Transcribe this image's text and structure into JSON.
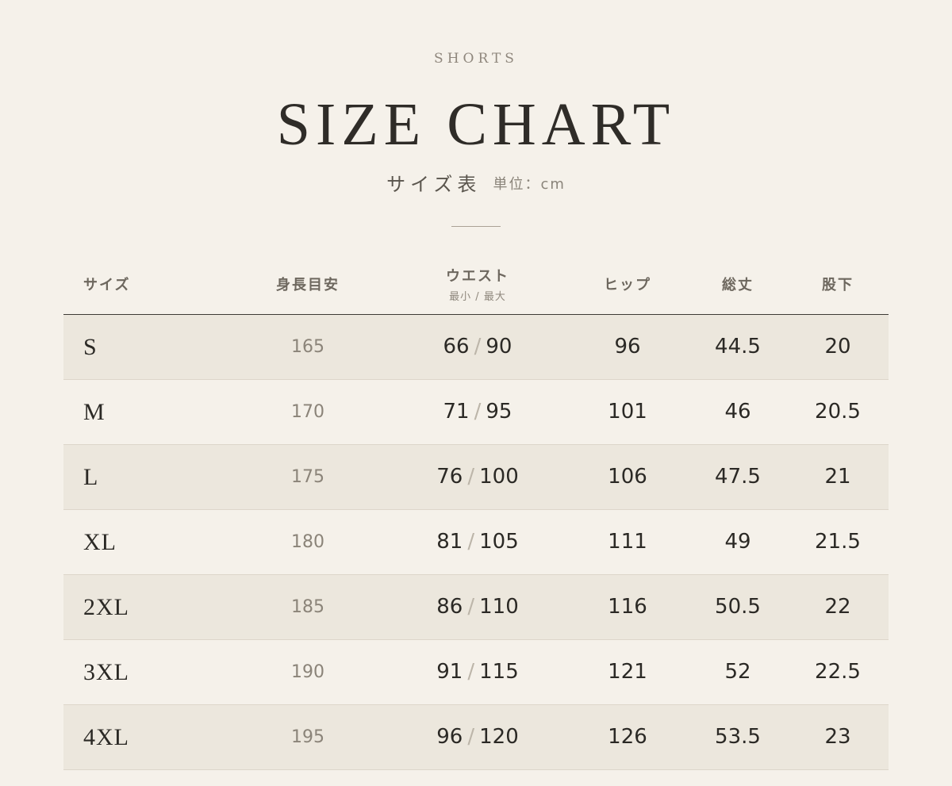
{
  "header": {
    "eyebrow": "SHORTS",
    "title": "SIZE CHART",
    "subtitle_jp": "サイズ表",
    "unit": "単位：cm"
  },
  "table": {
    "columns": {
      "size": "サイズ",
      "height": "身長目安",
      "waist": "ウエスト",
      "waist_sub": "最小 / 最大",
      "hip": "ヒップ",
      "length": "総丈",
      "inseam": "股下"
    },
    "rows": [
      {
        "size": "S",
        "height": "165",
        "waist_min": "66",
        "waist_max": "90",
        "hip": "96",
        "length": "44.5",
        "inseam": "20"
      },
      {
        "size": "M",
        "height": "170",
        "waist_min": "71",
        "waist_max": "95",
        "hip": "101",
        "length": "46",
        "inseam": "20.5"
      },
      {
        "size": "L",
        "height": "175",
        "waist_min": "76",
        "waist_max": "100",
        "hip": "106",
        "length": "47.5",
        "inseam": "21"
      },
      {
        "size": "XL",
        "height": "180",
        "waist_min": "81",
        "waist_max": "105",
        "hip": "111",
        "length": "49",
        "inseam": "21.5"
      },
      {
        "size": "2XL",
        "height": "185",
        "waist_min": "86",
        "waist_max": "110",
        "hip": "116",
        "length": "50.5",
        "inseam": "22"
      },
      {
        "size": "3XL",
        "height": "190",
        "waist_min": "91",
        "waist_max": "115",
        "hip": "121",
        "length": "52",
        "inseam": "22.5"
      },
      {
        "size": "4XL",
        "height": "195",
        "waist_min": "96",
        "waist_max": "120",
        "hip": "126",
        "length": "53.5",
        "inseam": "23"
      }
    ]
  },
  "colors": {
    "background": "#f5f1ea",
    "row_shaded": "#ece7dd",
    "text_primary": "#2b2925",
    "text_muted": "#8b8479"
  }
}
